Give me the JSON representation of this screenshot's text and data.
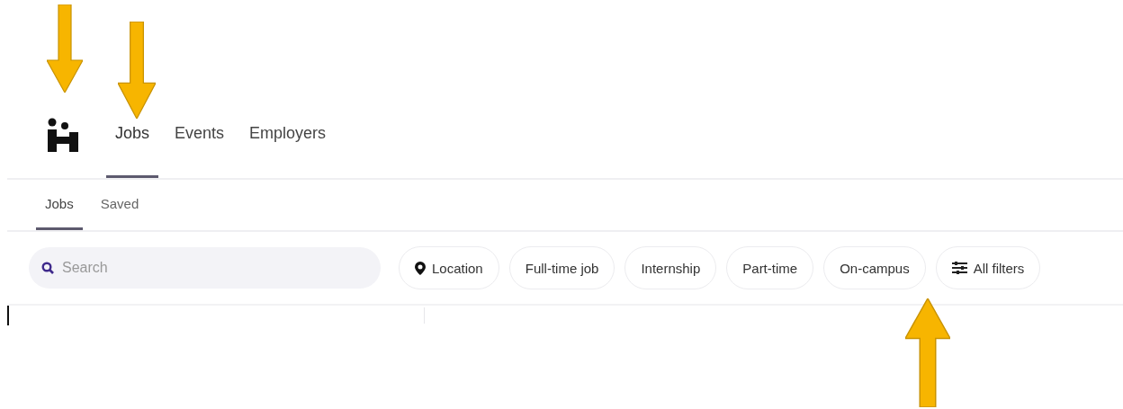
{
  "nav": {
    "tabs": [
      {
        "label": "Jobs",
        "selected": true
      },
      {
        "label": "Events",
        "selected": false
      },
      {
        "label": "Employers",
        "selected": false
      }
    ]
  },
  "subnav": {
    "tabs": [
      {
        "label": "Jobs",
        "selected": true
      },
      {
        "label": "Saved",
        "selected": false
      }
    ]
  },
  "search": {
    "placeholder": "Search"
  },
  "filters": [
    {
      "label": "Location",
      "kind": "location"
    },
    {
      "label": "Full-time job",
      "kind": "plain"
    },
    {
      "label": "Internship",
      "kind": "plain"
    },
    {
      "label": "Part-time",
      "kind": "plain"
    },
    {
      "label": "On-campus",
      "kind": "plain"
    },
    {
      "label": "All filters",
      "kind": "settings"
    }
  ],
  "annotations": [
    {
      "kind": "down"
    },
    {
      "kind": "down"
    },
    {
      "kind": "up"
    }
  ]
}
